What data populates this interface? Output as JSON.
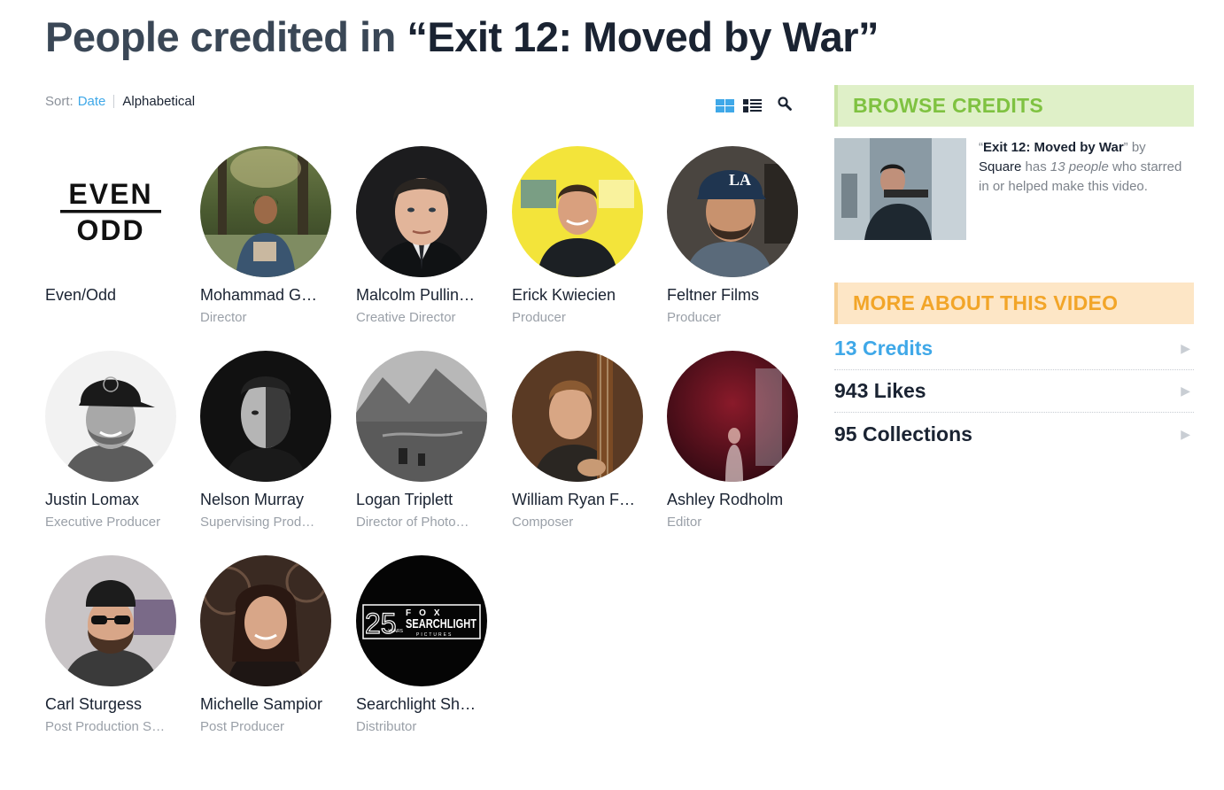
{
  "title": {
    "prefix": "People credited in ",
    "open_quote": "“",
    "video_name": "Exit 12: Moved by War",
    "close_quote": "”"
  },
  "sort": {
    "label": "Sort:",
    "options": [
      "Date",
      "Alphabetical"
    ],
    "active": "Date"
  },
  "view": {
    "grid_icon": "grid-view-icon",
    "list_icon": "list-view-icon",
    "search_icon": "search-icon"
  },
  "credits": [
    {
      "name": "Even/Odd",
      "role": ""
    },
    {
      "name": "Mohammad G…",
      "role": "Director"
    },
    {
      "name": "Malcolm Pullin…",
      "role": "Creative Director"
    },
    {
      "name": "Erick Kwiecien",
      "role": "Producer"
    },
    {
      "name": "Feltner Films",
      "role": "Producer"
    },
    {
      "name": "Justin Lomax",
      "role": "Executive Producer"
    },
    {
      "name": "Nelson Murray",
      "role": "Supervising Prod…"
    },
    {
      "name": "Logan Triplett",
      "role": "Director of Photo…"
    },
    {
      "name": "William Ryan F…",
      "role": "Composer"
    },
    {
      "name": "Ashley Rodholm",
      "role": "Editor"
    },
    {
      "name": "Carl Sturgess",
      "role": "Post Production S…"
    },
    {
      "name": "Michelle Sampior",
      "role": "Post Producer"
    },
    {
      "name": "Searchlight Sh…",
      "role": "Distributor"
    }
  ],
  "logos": {
    "even_odd": [
      "EVEN",
      "ODD"
    ],
    "searchlight": {
      "years_number": "25",
      "years_label": "YEARS",
      "top": "FOX",
      "mid": "SEARCHLIGHT",
      "bottom": "PICTURES"
    }
  },
  "sidebar": {
    "browse_header": "BROWSE CREDITS",
    "browse": {
      "open_quote": "“",
      "video_name": "Exit 12: Moved by War",
      "close_quote_by": "” by",
      "owner": "Square",
      "has": " has ",
      "count_text": "13 people",
      "rest": " who starred in or helped make this video."
    },
    "more_header": "MORE ABOUT THIS VIDEO",
    "stats": [
      {
        "label": "13 Credits",
        "arrow": "▶"
      },
      {
        "label": "943 Likes",
        "arrow": "▶"
      },
      {
        "label": "95 Collections",
        "arrow": "▶"
      }
    ]
  },
  "colors": {
    "accent_blue": "#3fa8e8",
    "browse_green": "#7fc241",
    "more_orange": "#f2a528",
    "title_dark": "#1a2332"
  }
}
